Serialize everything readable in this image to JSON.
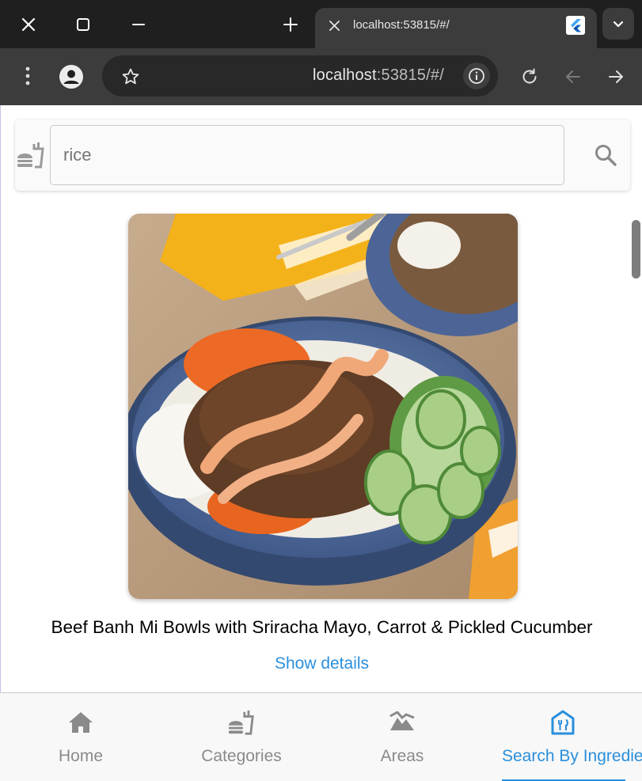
{
  "browser": {
    "tab_title": "localhost:53815/#/",
    "url_host": "localhost",
    "url_rest": ":53815/#/"
  },
  "search": {
    "placeholder": "rice",
    "value": ""
  },
  "meal": {
    "title": "Beef Banh Mi Bowls with Sriracha Mayo, Carrot & Pickled Cucumber",
    "details_link": "Show details"
  },
  "nav": {
    "items": [
      {
        "label": "Home",
        "icon": "home-icon"
      },
      {
        "label": "Categories",
        "icon": "fastfood-icon"
      },
      {
        "label": "Areas",
        "icon": "landscape-icon"
      },
      {
        "label": "Search By Ingredient",
        "icon": "storefront-icon"
      }
    ],
    "active_index": 3
  },
  "colors": {
    "accent": "#2a8fdc",
    "inactive": "#8a8a8a",
    "chrome_dark": "#1f1f1f",
    "chrome_toolbar": "#3c3c3c"
  }
}
